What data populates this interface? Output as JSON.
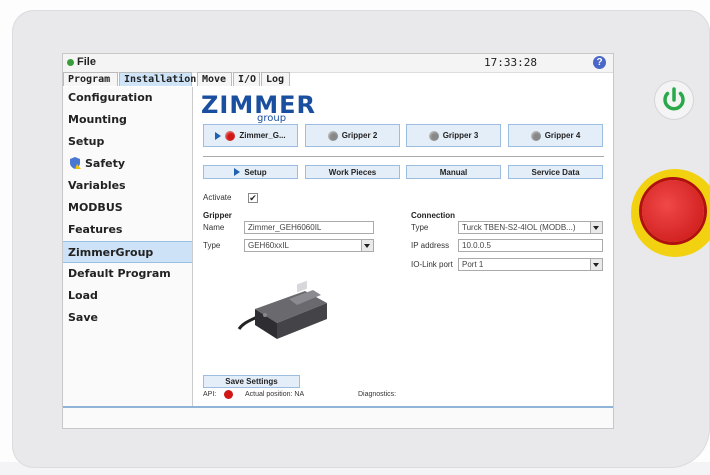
{
  "titlebar": {
    "file_label": "File",
    "clock": "17:33:28",
    "help_glyph": "?"
  },
  "tabs": [
    {
      "label": "Program",
      "active": false
    },
    {
      "label": "Installation",
      "active": true
    },
    {
      "label": "Move",
      "active": false
    },
    {
      "label": "I/O",
      "active": false
    },
    {
      "label": "Log",
      "active": false
    }
  ],
  "sidebar": {
    "items": [
      {
        "label": "Configuration"
      },
      {
        "label": "Mounting"
      },
      {
        "label": "Setup"
      },
      {
        "label": "Safety",
        "icon": "shield-icon"
      },
      {
        "label": "Variables"
      },
      {
        "label": "MODBUS"
      },
      {
        "label": "Features"
      },
      {
        "label": "ZimmerGroup",
        "active": true
      },
      {
        "label": "Default Program"
      },
      {
        "label": "Load"
      },
      {
        "label": "Save"
      }
    ]
  },
  "logo": {
    "text": "ZIMMER",
    "sub": "group"
  },
  "grippers": [
    {
      "label": "Zimmer_G...",
      "status_color": "#d01818",
      "selected": true
    },
    {
      "label": "Gripper 2",
      "status_color": "#888888"
    },
    {
      "label": "Gripper 3",
      "status_color": "#888888"
    },
    {
      "label": "Gripper 4",
      "status_color": "#888888"
    }
  ],
  "subtabs": [
    {
      "label": "Setup",
      "selected": true
    },
    {
      "label": "Work Pieces"
    },
    {
      "label": "Manual"
    },
    {
      "label": "Service Data"
    }
  ],
  "activate": {
    "label": "Activate",
    "checked": true,
    "check_glyph": "✔"
  },
  "gripper_section": {
    "title": "Gripper",
    "name_label": "Name",
    "name_value": "Zimmer_GEH6060IL",
    "type_label": "Type",
    "type_value": "GEH60xxIL"
  },
  "connection_section": {
    "title": "Connection",
    "type_label": "Type",
    "type_value": "Turck TBEN-S2-4IOL (MODB...)",
    "ip_label": "IP address",
    "ip_value": "10.0.0.5",
    "port_label": "IO-Link port",
    "port_value": "Port 1"
  },
  "save_button": "Save Settings",
  "status": {
    "api_label": "API:",
    "position_label": "Actual position: NA",
    "diagnostics_label": "Diagnostics:"
  },
  "colors": {
    "accent": "#1a4fa0",
    "selected_tab": "#cfe4f7",
    "estop_red": "#d01818",
    "estop_yellow": "#f2d210",
    "power_green": "#2aa84a"
  }
}
